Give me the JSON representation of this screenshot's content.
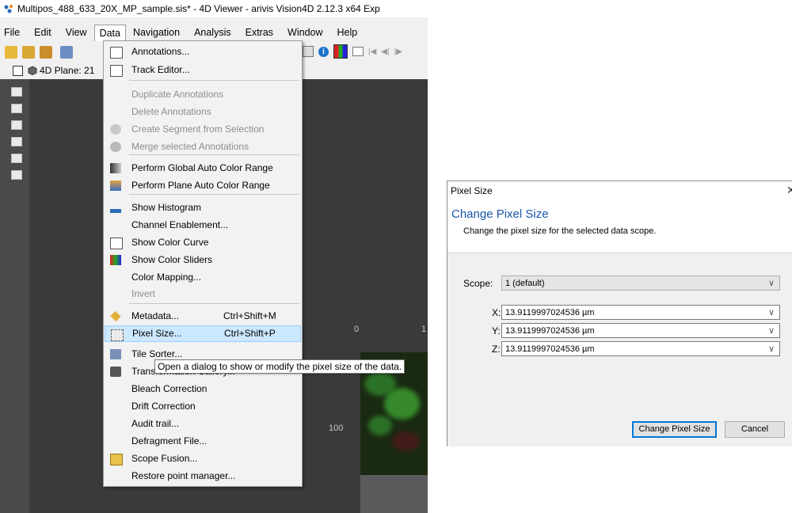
{
  "app": {
    "title": "Multipos_488_633_20X_MP_sample.sis* - 4D Viewer - arivis Vision4D 2.12.3 x64 Exp",
    "menubar": [
      "File",
      "Edit",
      "View",
      "Data",
      "Navigation",
      "Analysis",
      "Extras",
      "Window",
      "Help"
    ],
    "plane_label": "4D  Plane: 21",
    "axis_ticks": {
      "t0": "0",
      "t1": "1",
      "t100": "100"
    }
  },
  "data_menu": {
    "items": [
      {
        "label": "Annotations...",
        "icon": "table-icon"
      },
      {
        "label": "Track Editor...",
        "icon": "track-editor-icon"
      },
      {
        "label": "Duplicate Annotations",
        "disabled": true
      },
      {
        "label": "Delete Annotations",
        "disabled": true
      },
      {
        "label": "Create Segment from Selection",
        "disabled": true,
        "icon": "segment-icon"
      },
      {
        "label": "Merge selected Annotations",
        "disabled": true,
        "icon": "merge-icon"
      },
      {
        "label": "Perform Global Auto Color Range",
        "icon": "global-color-range-icon"
      },
      {
        "label": "Perform Plane Auto Color Range",
        "icon": "plane-color-range-icon"
      },
      {
        "label": "Show Histogram",
        "icon": "histogram-icon"
      },
      {
        "label": "Channel Enablement..."
      },
      {
        "label": "Show Color Curve",
        "icon": "color-curve-icon"
      },
      {
        "label": "Show Color Sliders",
        "icon": "color-sliders-icon"
      },
      {
        "label": "Color Mapping..."
      },
      {
        "label": "Invert",
        "disabled": true
      },
      {
        "label": "Metadata...",
        "shortcut": "Ctrl+Shift+M",
        "icon": "tag-icon"
      },
      {
        "label": "Pixel Size...",
        "shortcut": "Ctrl+Shift+P",
        "icon": "pixel-size-icon",
        "highlighted": true
      },
      {
        "label": "Tile Sorter...",
        "icon": "tile-sorter-icon"
      },
      {
        "label": "Transformation Gallery...",
        "icon": "cube-icon"
      },
      {
        "label": "Bleach Correction"
      },
      {
        "label": "Drift Correction"
      },
      {
        "label": "Audit trail..."
      },
      {
        "label": "Defragment File..."
      },
      {
        "label": "Scope Fusion...",
        "icon": "scope-fusion-icon"
      },
      {
        "label": "Restore point manager..."
      }
    ],
    "tooltip": "Open a dialog to show or modify the pixel size of the data."
  },
  "dialog": {
    "window_title": "Pixel Size",
    "heading": "Change Pixel Size",
    "description": "Change the pixel size for the selected data scope.",
    "scope_label": "Scope:",
    "scope_value": "1 (default)",
    "x_label": "X:",
    "x_value": "13.9119997024536 µm",
    "y_label": "Y:",
    "y_value": "13.9119997024536 µm",
    "z_label": "Z:",
    "z_value": "13.9119997024536 µm",
    "ok_label": "Change Pixel Size",
    "cancel_label": "Cancel",
    "close_glyph": "✕"
  }
}
